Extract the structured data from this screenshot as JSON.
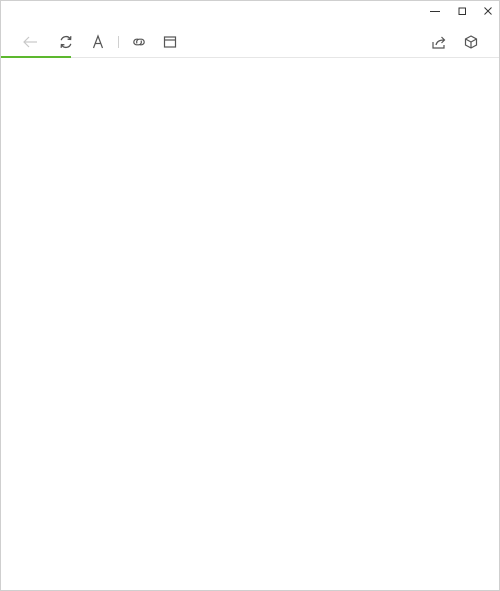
{
  "window": {
    "controls": {
      "minimize_icon": "minimize-icon",
      "maximize_icon": "maximize-icon",
      "close_icon": "close-icon"
    }
  },
  "toolbar": {
    "items": [
      {
        "icon": "back-arrow-icon",
        "enabled": false
      },
      {
        "icon": "refresh-icon",
        "enabled": true
      },
      {
        "icon": "font-icon",
        "enabled": true
      },
      {
        "icon": "link-icon",
        "enabled": true
      },
      {
        "icon": "reader-view-icon",
        "enabled": true
      },
      {
        "icon": "share-icon",
        "enabled": true
      },
      {
        "icon": "package-icon",
        "enabled": true
      }
    ]
  },
  "loading_progress": 0.14,
  "colors": {
    "progress": "#5cb82e",
    "icon": "#555555",
    "icon_disabled": "#c8c8c8",
    "border": "#cfcfcf"
  }
}
